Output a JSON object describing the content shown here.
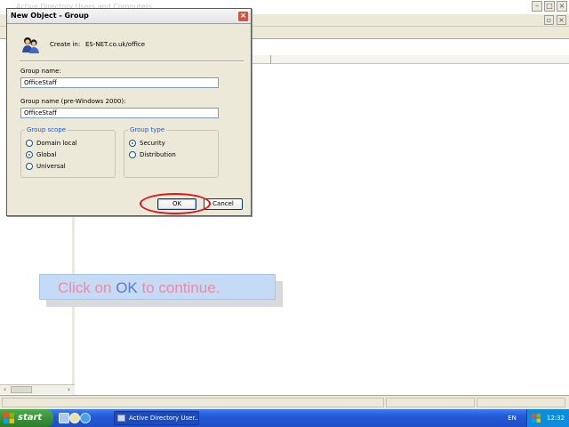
{
  "mmc": {
    "title": "Active Directory Users and Computers"
  },
  "dialog": {
    "title": "New Object - Group",
    "create_in_label": "Create in:",
    "create_in_value": "ES-NET.co.uk/office",
    "group_name_label": "Group name:",
    "group_name_value": "OfficeStaff",
    "group_name_pre2000_label": "Group name (pre-Windows 2000):",
    "group_name_pre2000_value": "OfficeStaff",
    "group_scope": {
      "legend": "Group scope",
      "options": [
        "Domain local",
        "Global",
        "Universal"
      ],
      "selected": "Global"
    },
    "group_type": {
      "legend": "Group type",
      "options": [
        "Security",
        "Distribution"
      ],
      "selected": "Security"
    },
    "ok_label": "OK",
    "cancel_label": "Cancel",
    "highlight_color": "#e0131a"
  },
  "callout": {
    "part1": "Click on ",
    "part2": "OK",
    "part3": " to continue.",
    "colors": {
      "text": "#ef8aa6",
      "accent": "#5a79d4",
      "background": "#c4daf5"
    }
  },
  "taskbar": {
    "start_label": "start",
    "task_label": "Active Directory User...",
    "language": "EN",
    "clock": "12:32"
  }
}
